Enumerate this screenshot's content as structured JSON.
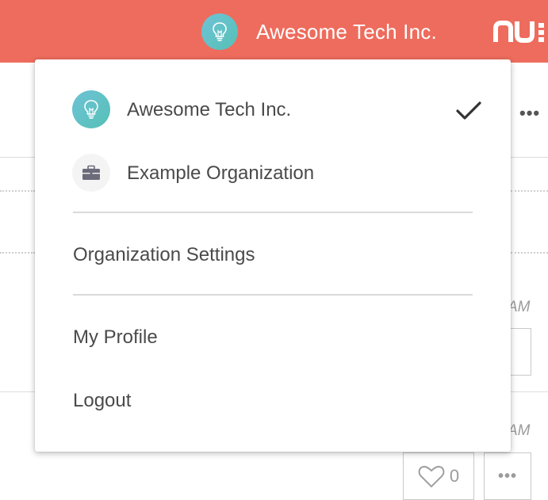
{
  "topbar": {
    "org_name": "Awesome Tech Inc.",
    "logo_text": "nu"
  },
  "background": {
    "more_label": "•••",
    "time_suffix_1": "AM",
    "time_suffix_2": "AM",
    "like_count": "0",
    "box_more_label": "•••"
  },
  "dropdown": {
    "organizations": [
      {
        "name": "Awesome Tech Inc.",
        "icon": "lightbulb-icon",
        "selected": true
      },
      {
        "name": "Example Organization",
        "icon": "briefcase-icon",
        "selected": false
      }
    ],
    "settings_label": "Organization Settings",
    "profile_label": "My Profile",
    "logout_label": "Logout"
  },
  "colors": {
    "topbar_bg": "#ee6c5d",
    "avatar_gradient_start": "#6ec3d6",
    "avatar_gradient_end": "#56c0b6",
    "text": "#4a4a4a"
  }
}
